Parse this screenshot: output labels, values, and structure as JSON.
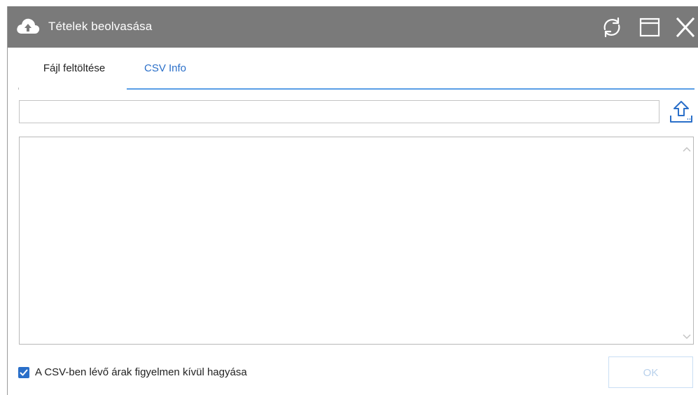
{
  "window": {
    "title": "Tételek beolvasása",
    "title_icon": "cloud-upload-icon",
    "controls": [
      "refresh-icon",
      "maximize-icon",
      "close-icon"
    ]
  },
  "tabs": [
    {
      "label": "Fájl feltöltése",
      "active": false
    },
    {
      "label": "CSV Info",
      "active": true
    }
  ],
  "file_path": {
    "value": "",
    "placeholder": ""
  },
  "upload_button_icon": "upload-icon",
  "csv_text": {
    "value": ""
  },
  "ignore_prices": {
    "label": "A CSV-ben lévő árak figyelmen kívül hagyása",
    "checked": true
  },
  "ok_button": {
    "label": "OK",
    "enabled": false
  },
  "colors": {
    "titlebar": "#7a7a7a",
    "accent": "#2a6fc9",
    "tab_underline": "#5a9ee6",
    "disabled_button_text": "#b9d1ec"
  }
}
